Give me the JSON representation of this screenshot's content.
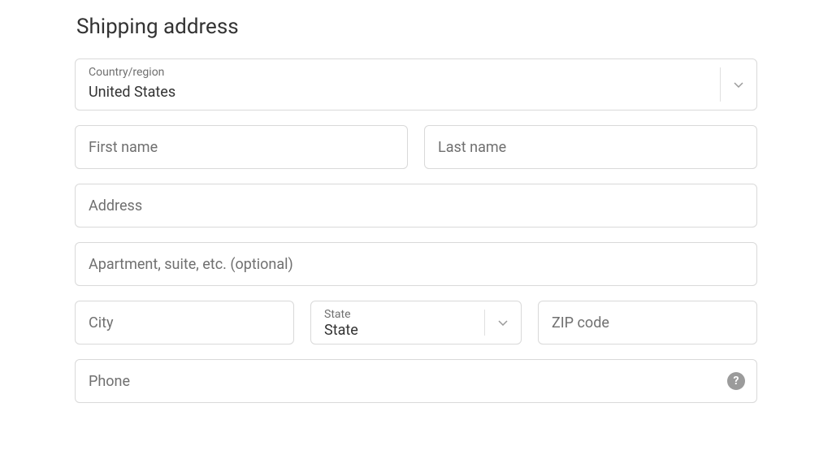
{
  "heading": "Shipping address",
  "country": {
    "label": "Country/region",
    "value": "United States"
  },
  "first_name": {
    "placeholder": "First name"
  },
  "last_name": {
    "placeholder": "Last name"
  },
  "address": {
    "placeholder": "Address"
  },
  "apartment": {
    "placeholder": "Apartment, suite, etc. (optional)"
  },
  "city": {
    "placeholder": "City"
  },
  "state": {
    "label": "State",
    "value": "State"
  },
  "zip": {
    "placeholder": "ZIP code"
  },
  "phone": {
    "placeholder": "Phone"
  },
  "icons": {
    "help": "?"
  }
}
